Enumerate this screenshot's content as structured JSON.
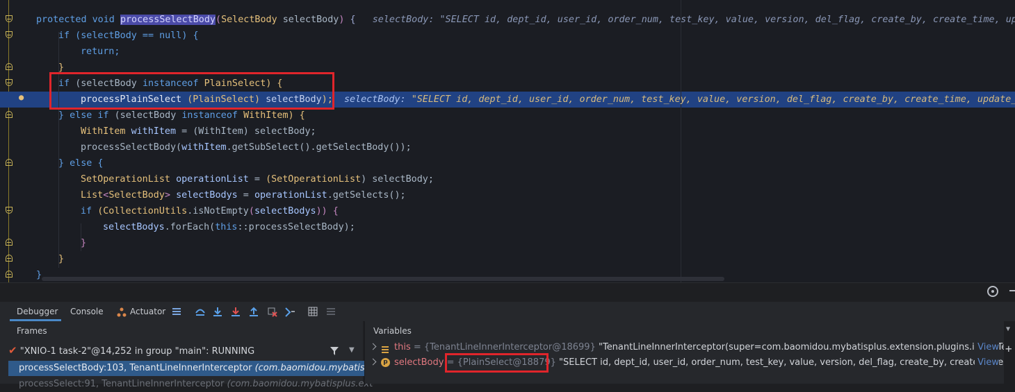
{
  "editor": {
    "lines": [
      {
        "id": "l1"
      },
      {
        "id": "l2"
      }
    ],
    "signature": {
      "protected": "protected",
      "void": "void",
      "method": "processSelectBody",
      "param_type": "SelectBody",
      "param_name": "selectBody",
      "hint_key": "selectBody:",
      "hint_val": "\"SELECT id, dept_id, user_id, order_num, test_key, value, version, del_flag, create_by, create_time, upda"
    },
    "l_if_null": "if (selectBody == null) {",
    "l_return": "return;",
    "l_close1": "}",
    "l_if_plain_if": "if",
    "l_if_plain_mid": "(selectBody",
    "l_instanceof": "instanceof",
    "l_plain_type": "PlainSelect",
    "l_if_plain_end": ") {",
    "l_process_plain": "processPlainSelect",
    "l_cast_type": "PlainSelect",
    "l_cast_var": "selectBody",
    "l_hint_key": "selectBody:",
    "l_hint_val": "\"SELECT id, dept_id, user_id, order_num, test_key, value, version, del_flag, create_by, create_time, update_b",
    "l_else_if": "} else if",
    "l_else_if_mid": "(selectBody",
    "l_withitem_type": "WithItem",
    "l_else_if_end": ") {",
    "l_withitem_decl_type": "WithItem",
    "l_withitem_var": "withItem",
    "l_withitem_cast": "(WithItem) selectBody;",
    "l_process_sub_a": "processSelectBody(",
    "l_process_sub_b": "withItem",
    "l_process_sub_c": ".getSubSelect().getSelectBody());",
    "l_else": "} else {",
    "l_setop_type": "SetOperationList",
    "l_setop_var": "operationList",
    "l_setop_cast_type": "SetOperationList",
    "l_setop_cast_rest": ") selectBody;",
    "l_list": "List",
    "l_list_generic": "SelectBody",
    "l_list_var": "selectBodys",
    "l_list_rest_a": "operationList",
    "l_list_rest_b": ".getSelects();",
    "l_if_coll": "if",
    "l_coll_util": "CollectionUtils",
    "l_coll_method": ".isNotEmpty",
    "l_coll_arg": "selectBodys",
    "l_coll_end": ")) {",
    "l_foreach_a": "selectBodys",
    "l_foreach_b": ".forEach(",
    "l_foreach_this": "this",
    "l_foreach_c": "::processSelectBody);",
    "l_close_a": "}",
    "l_close_b": "}",
    "l_close_c": "}"
  },
  "debugger": {
    "tabs": [
      "Debugger",
      "Console",
      "Actuator"
    ],
    "frames_title": "Frames",
    "variables_title": "Variables",
    "thread": "\"XNIO-1 task-2\"@14,252 in group \"main\": RUNNING",
    "frames": [
      {
        "method": "processSelectBody:103, TenantLineInnerInterceptor",
        "pkg": "(com.baomidou.mybatisplus.extension"
      },
      {
        "method": "processSelect:91, TenantLineInnerInterceptor",
        "pkg": "(com.baomidou.mybatisplus.extens"
      }
    ],
    "variables": [
      {
        "name": "this",
        "eq": " = ",
        "type": "{TenantLineInnerInterceptor@18699}",
        "value": " \"TenantLineInnerInterceptor(super=com.baomidou.mybatisplus.extension.plugins.inner.Tena...",
        "link": "View"
      },
      {
        "name": "selectBody",
        "eq": " = ",
        "type": "{PlainSelect@18879}",
        "value": " \"SELECT id, dept_id, user_id, order_num, test_key, value, version, del_flag, create_by, create_time, upd...",
        "link": "View"
      }
    ]
  },
  "colors": {
    "editor_bg": "#1b1d23",
    "highlight_line": "#214283",
    "annotation_red": "#e0252b"
  }
}
